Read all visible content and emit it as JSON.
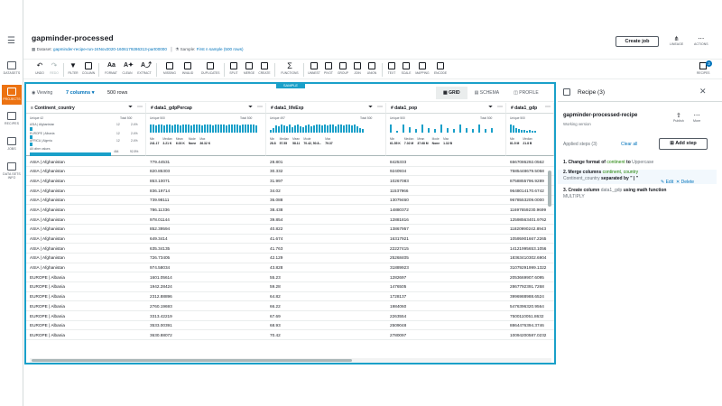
{
  "leftnav": {
    "items": [
      {
        "label": "DATASETS"
      },
      {
        "label": "PROJECTS"
      },
      {
        "label": "RECIPES"
      },
      {
        "label": "JOBS"
      },
      {
        "label": "DATA SETS INFO"
      }
    ]
  },
  "header": {
    "title": "gapminder-processed",
    "dataset_label": "Dataset:",
    "dataset_link": "gapminder-recipe-run-24Nov2020-1606179286313-part00000",
    "sample_label": "Sample:",
    "sample_link": "First n sample (500 rows)",
    "create_job": "Create job",
    "lineage": "LINEAGE",
    "actions": "ACTIONS"
  },
  "toolbar": {
    "items": [
      "UNDO",
      "REDO",
      "FILTER",
      "COLUMN",
      "FORMAT",
      "CLEAN",
      "EXTRACT",
      "MISSING",
      "INVALID",
      "DUPLICATES",
      "SPLIT",
      "MERGE",
      "CREATE",
      "FUNCTIONS",
      "UNNEST",
      "PIVOT",
      "GROUP",
      "JOIN",
      "UNION",
      "TEXT",
      "SCALE",
      "MAPPING",
      "ENCODE"
    ],
    "recipes": "RECIPES",
    "recipes_count": "3"
  },
  "grid": {
    "sample_tag": "SAMPLE",
    "viewing": "Viewing",
    "columns_selector": "7 columns",
    "rows_count": "500 rows",
    "view_tabs": [
      "GRID",
      "SCHEMA",
      "PROFILE"
    ],
    "columns": [
      {
        "name": "Continent_country",
        "unique": "Unique 42",
        "total": "Total 500",
        "cats": [
          {
            "label": "ASIA | Afghanistan",
            "count": "12",
            "pct": "2.4%"
          },
          {
            "label": "EUROPE | Albania",
            "count": "12",
            "pct": "2.4%"
          },
          {
            "label": "AFRICA | Algeria",
            "count": "12",
            "pct": "2.4%"
          },
          {
            "label": "All other values",
            "count": "464",
            "pct": "92.8%"
          }
        ]
      },
      {
        "name": "data1_gdpPercap",
        "unique": "Unique 500",
        "total": "Total 500",
        "stats": [
          [
            "Min",
            "241.17"
          ],
          [
            "Median",
            "3.21 K"
          ],
          [
            "Mean",
            "6.03 K"
          ],
          [
            "Mode",
            "None"
          ],
          [
            "Max",
            "36.32 K"
          ]
        ]
      },
      {
        "name": "data1_lifeExp",
        "unique": "Unique 497",
        "total": "Total 500",
        "stats": [
          [
            "Min",
            "28.8"
          ],
          [
            "Median",
            "57.55"
          ],
          [
            "Mean",
            "58.11"
          ],
          [
            "Mode",
            "70.42, 50.8..."
          ],
          [
            "Max",
            "79.37"
          ]
        ]
      },
      {
        "name": "data1_pop",
        "unique": "Unique 500",
        "total": "Total 500",
        "stats": [
          [
            "Min",
            "61.55 K"
          ],
          [
            "Median",
            "7.02 M"
          ],
          [
            "Mean",
            "37.68 M"
          ],
          [
            "Mode",
            "None"
          ],
          [
            "Max",
            "1.32 B"
          ]
        ]
      },
      {
        "name": "data1_gdp",
        "unique": "Unique 500",
        "total": "Total 500",
        "stats": [
          [
            "Min",
            "81.5 M"
          ],
          [
            "Median",
            "21.8 B"
          ]
        ]
      }
    ],
    "rows": [
      [
        "ASIA | Afghanistan",
        "779.44531",
        "28.801",
        "8425333",
        "6567086292.0562"
      ],
      [
        "ASIA | Afghanistan",
        "820.85303",
        "30.332",
        "9240934",
        "7585448679.5058"
      ],
      [
        "ASIA | Afghanistan",
        "853.10071",
        "31.997",
        "10267083",
        "8758855796.9289"
      ],
      [
        "ASIA | Afghanistan",
        "836.19714",
        "34.02",
        "11537966",
        "9648014170.6742"
      ],
      [
        "ASIA | Afghanistan",
        "739.98111",
        "36.088",
        "13079460",
        "9678553209.0000"
      ],
      [
        "ASIA | Afghanistan",
        "786.11336",
        "38.438",
        "14880372",
        "11697659230.9699"
      ],
      [
        "ASIA | Afghanistan",
        "978.01144",
        "39.854",
        "12881816",
        "12598563401.9762"
      ],
      [
        "ASIA | Afghanistan",
        "852.39594",
        "40.822",
        "13867957",
        "11820990242.8943"
      ],
      [
        "ASIA | Afghanistan",
        "649.3414",
        "41.674",
        "16317921",
        "10595901667.2265"
      ],
      [
        "ASIA | Afghanistan",
        "635.34135",
        "41.763",
        "22227415",
        "14121995653.1056"
      ],
      [
        "ASIA | Afghanistan",
        "726.73405",
        "42.129",
        "25268405",
        "18363410302.6904"
      ],
      [
        "ASIA | Afghanistan",
        "974.58034",
        "43.828",
        "31889923",
        "31079291999.1322"
      ],
      [
        "EUROPE | Albania",
        "1601.05614",
        "55.23",
        "1282697",
        "2053669907.6095"
      ],
      [
        "EUROPE | Albania",
        "1942.28424",
        "59.28",
        "1476505",
        "2867792391.7268"
      ],
      [
        "EUROPE | Albania",
        "2312.88896",
        "64.82",
        "1728137",
        "3996988988.6524"
      ],
      [
        "EUROPE | Albania",
        "2760.19693",
        "66.22",
        "1984060",
        "5476396320.9564"
      ],
      [
        "EUROPE | Albania",
        "3313.42219",
        "67.69",
        "2263554",
        "7500110051.8632"
      ],
      [
        "EUROPE | Albania",
        "3533.00391",
        "68.93",
        "2509048",
        "8864476394.3746"
      ],
      [
        "EUROPE | Albania",
        "3630.88072",
        "70.42",
        "2780097",
        "10094200587.0232"
      ]
    ]
  },
  "panel": {
    "title": "Recipe (3)",
    "recipe_name": "gapminder-processed-recipe",
    "version": "Working version",
    "publish": "Publish",
    "more": "More",
    "applied_steps": "Applied steps (3)",
    "clear_all": "Clear all",
    "add_step": "Add step",
    "steps": {
      "s1": {
        "a": "1. Change format of ",
        "b": "continent",
        "c": " to ",
        "d": "Uppercase"
      },
      "s2": {
        "a": "2. Merge columns ",
        "b": "continent, country",
        "c": "Continent_country",
        "d": " separated by \" | \""
      },
      "s3": {
        "a": "3. Create column ",
        "b": "data1_gdp",
        "c": " using math function",
        "d": "MULTIPLY"
      }
    },
    "edit": "Edit",
    "delete": "Delete"
  },
  "colors": {
    "accent": "#1aa0c9",
    "link": "#0073bb",
    "nav_active": "#ec7211",
    "green": "#1d8102"
  }
}
